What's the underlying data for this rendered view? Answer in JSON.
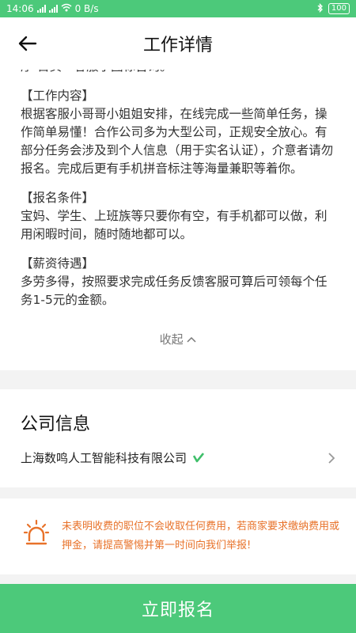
{
  "status_bar": {
    "time": "14:06",
    "network_speed": "0 B/s",
    "battery": "100"
  },
  "header": {
    "title": "工作详情"
  },
  "description": {
    "cut_line": "序-首页一客服小图标咨询。",
    "sections": [
      {
        "heading": "【工作内容】",
        "body": "根据客服小哥哥小姐姐安排，在线完成一些简单任务，操作简单易懂！合作公司多为大型公司，正规安全放心。有部分任务会涉及到个人信息（用于实名认证），介意者请勿报名。完成后更有手机拼音标注等海量兼职等着你。"
      },
      {
        "heading": "【报名条件】",
        "body": "宝妈、学生、上班族等只要你有空，有手机都可以做，利用闲暇时间，随时随地都可以。"
      },
      {
        "heading": "【薪资待遇】",
        "body": "多劳多得，按照要求完成任务反馈客服可算后可领每个任务1-5元的金额。"
      }
    ],
    "collapse_label": "收起"
  },
  "company": {
    "section_title": "公司信息",
    "name": "上海数鸣人工智能科技有限公司"
  },
  "warning": {
    "text": "未表明收费的职位不会收取任何费用，若商家要求缴纳费用或押金，请提高警惕并第一时间向我们举报!"
  },
  "cta": {
    "label": "立即报名"
  },
  "colors": {
    "brand_green": "#4cc97a",
    "warning_orange": "#e8722a",
    "verify_green": "#3fbf6a"
  }
}
